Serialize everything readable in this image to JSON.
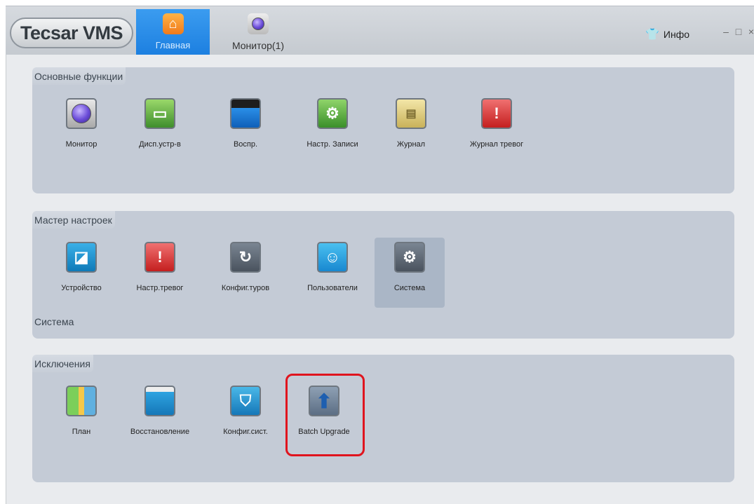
{
  "header": {
    "logo": "Tecsar VMS",
    "tabs": [
      {
        "label": "Главная",
        "icon": "home-icon",
        "active": true
      },
      {
        "label": "Монитор(1)",
        "icon": "camera-lens-icon",
        "active": false
      }
    ],
    "info_label": "Инфо",
    "window_controls": [
      "–",
      "□",
      "×"
    ]
  },
  "sections": [
    {
      "title": "Основные функции",
      "items": [
        {
          "label": "Монитор",
          "icon": "camera-lens-icon"
        },
        {
          "label": "Дисп.устр-в",
          "icon": "device-manager-icon"
        },
        {
          "label": "Воспр.",
          "icon": "playback-clapper-icon"
        },
        {
          "label": "Настр. Записи",
          "icon": "record-settings-icon"
        },
        {
          "label": "Журнал",
          "icon": "log-icon"
        },
        {
          "label": "Журнал тревог",
          "icon": "alarm-log-icon"
        }
      ]
    },
    {
      "title": "Мастер настроек",
      "items": [
        {
          "label": "Устройство",
          "icon": "device-config-icon"
        },
        {
          "label": "Настр.тревог",
          "icon": "alarm-settings-icon"
        },
        {
          "label": "Конфиг.туров",
          "icon": "tour-config-icon"
        },
        {
          "label": "Пользователи",
          "icon": "users-icon"
        },
        {
          "label": "Система",
          "icon": "gear-icon",
          "selected": true
        }
      ],
      "sub_label": "Система"
    },
    {
      "title": "Исключения",
      "items": [
        {
          "label": "План",
          "icon": "map-plan-icon"
        },
        {
          "label": "Восстановление",
          "icon": "restore-icon"
        },
        {
          "label": "Конфиг.сист.",
          "icon": "system-config-icon"
        },
        {
          "label": "Batch Upgrade",
          "icon": "upload-arrow-icon",
          "highlighted": true
        }
      ]
    }
  ],
  "colors": {
    "accent_blue": "#1c7fe0",
    "highlight_red": "#e0141e",
    "section_bg": "#c4cbd6"
  }
}
